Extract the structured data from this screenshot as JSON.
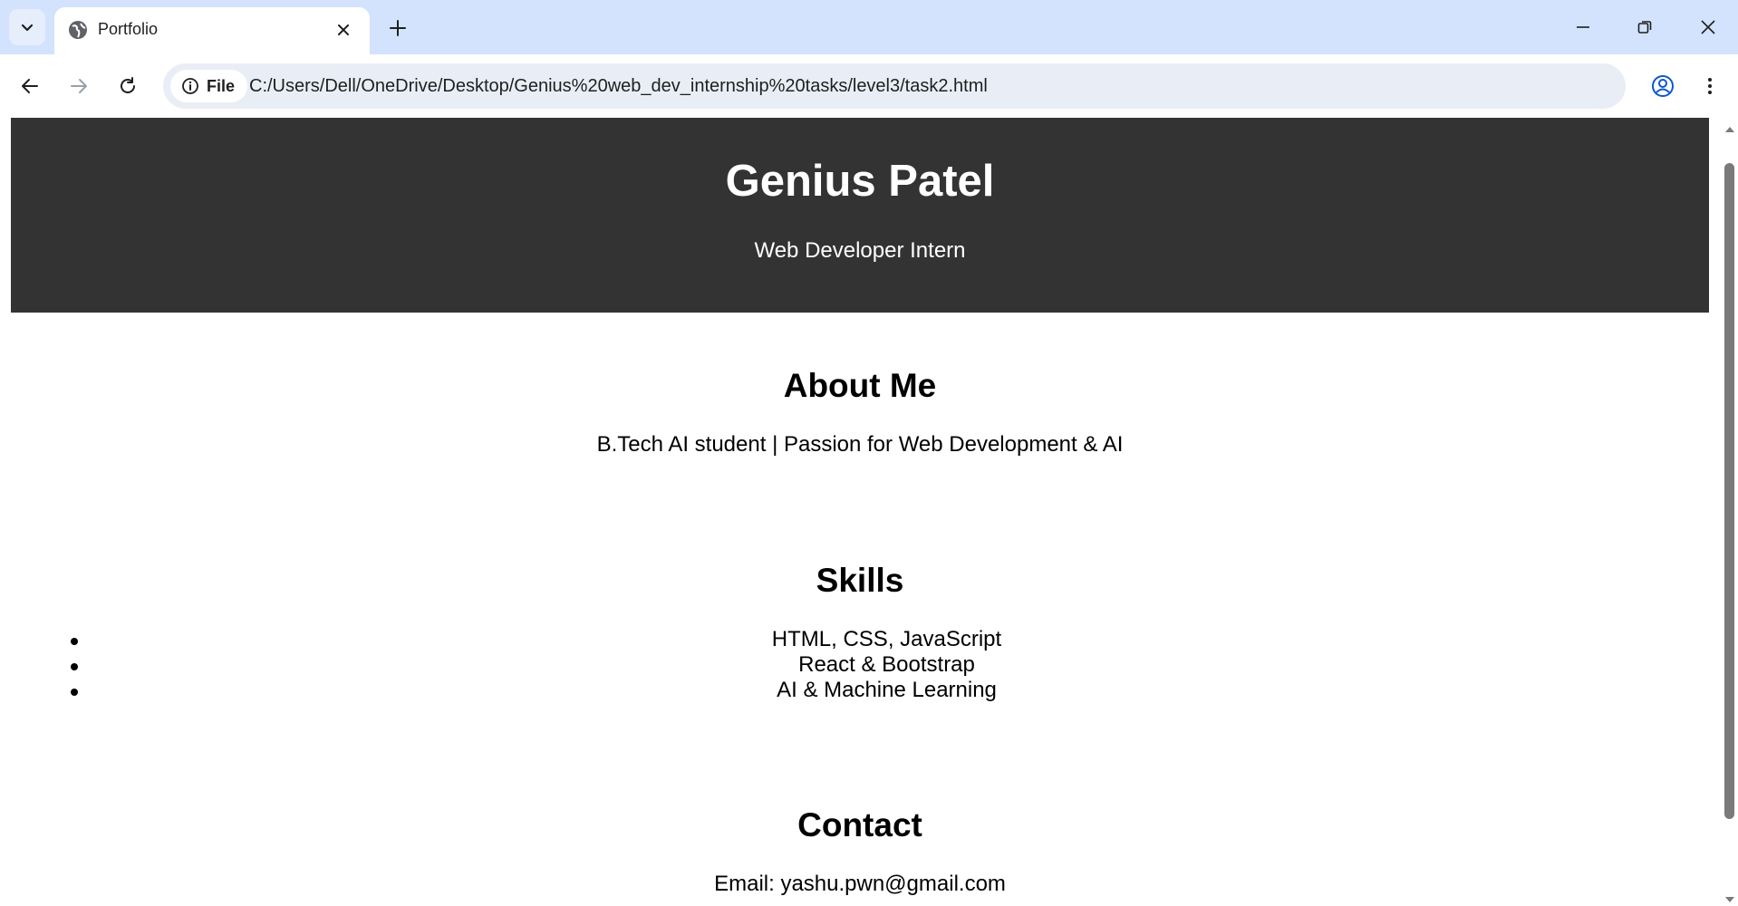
{
  "browser": {
    "tab": {
      "title": "Portfolio",
      "favicon": "globe-icon"
    },
    "site_chip_label": "File",
    "url": "C:/Users/Dell/OneDrive/Desktop/Genius%20web_dev_internship%20tasks/level3/task2.html",
    "accent_color": "#d3e3fd"
  },
  "page": {
    "hero": {
      "name": "Genius Patel",
      "role": "Web Developer Intern",
      "background": "#333333"
    },
    "about": {
      "title": "About Me",
      "text": "B.Tech AI student | Passion for Web Development & AI"
    },
    "skills": {
      "title": "Skills",
      "items": [
        "HTML, CSS, JavaScript",
        "React & Bootstrap",
        "AI & Machine Learning"
      ]
    },
    "contact": {
      "title": "Contact",
      "text": "Email: yashu.pwn@gmail.com"
    }
  }
}
